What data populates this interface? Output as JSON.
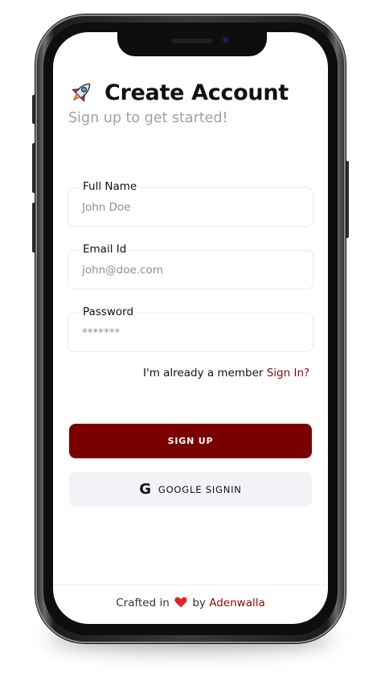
{
  "header": {
    "title": "Create Account",
    "subtitle": "Sign up to get started!",
    "icon": "rocket-icon"
  },
  "form": {
    "full_name": {
      "label": "Full Name",
      "placeholder": "John Doe"
    },
    "email": {
      "label": "Email Id",
      "placeholder": "john@doe.com"
    },
    "password": {
      "label": "Password",
      "placeholder": "*******"
    }
  },
  "member": {
    "text": "I'm already a member",
    "link": "Sign In?"
  },
  "buttons": {
    "signup": "SIGN UP",
    "google": "GOOGLE SIGNIN",
    "google_icon": "G"
  },
  "footer": {
    "prefix": "Crafted in",
    "icon": "heart-icon",
    "by": "by",
    "author": "Adenwalla"
  },
  "colors": {
    "primary": "#7a0000",
    "link": "#7a0b0b",
    "subtitle": "#9aa3ad",
    "google_bg": "#f1f3f7"
  }
}
